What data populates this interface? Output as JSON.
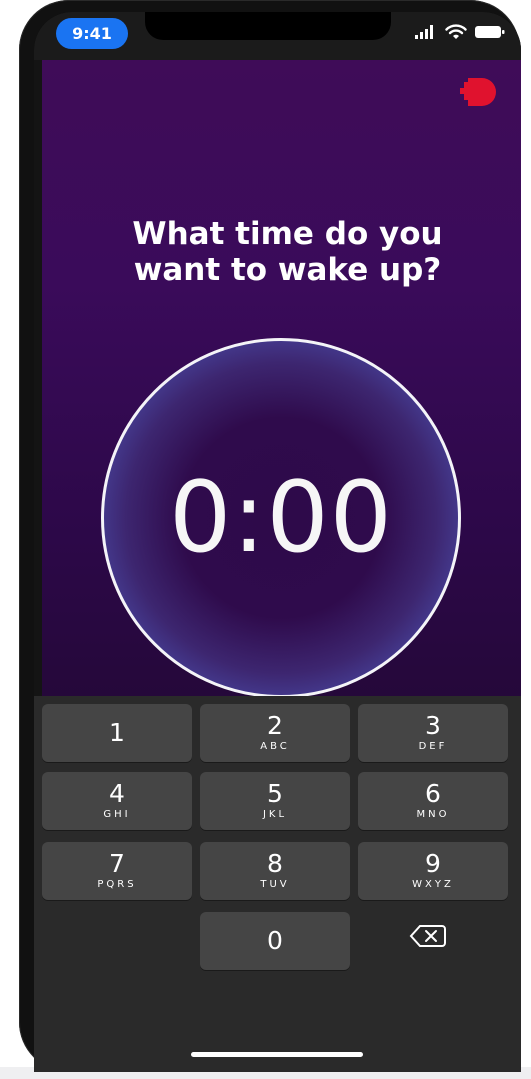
{
  "status_bar": {
    "time": "9:41",
    "icons": [
      "cellular-signal-icon",
      "wifi-icon",
      "battery-icon"
    ]
  },
  "header": {
    "menu_icon": "menu-blob-icon",
    "menu_color": "#e0122e"
  },
  "prompt": {
    "title": "What time do you\nwant to wake up?"
  },
  "alarm_input": {
    "value": "0:00"
  },
  "keypad": {
    "keys": [
      {
        "digit": "1",
        "letters": ""
      },
      {
        "digit": "2",
        "letters": "ABC"
      },
      {
        "digit": "3",
        "letters": "DEF"
      },
      {
        "digit": "4",
        "letters": "GHI"
      },
      {
        "digit": "5",
        "letters": "JKL"
      },
      {
        "digit": "6",
        "letters": "MNO"
      },
      {
        "digit": "7",
        "letters": "PQRS"
      },
      {
        "digit": "8",
        "letters": "TUV"
      },
      {
        "digit": "9",
        "letters": "WXYZ"
      },
      {
        "digit": "0",
        "letters": ""
      }
    ],
    "delete_icon": "backspace-icon"
  },
  "colors": {
    "accent_blue": "#1a74f2",
    "background_purple": "#3f0c58",
    "dial_rim": "#5360c4",
    "keyboard_bg": "#2a2a2a",
    "key_bg": "#454545"
  }
}
